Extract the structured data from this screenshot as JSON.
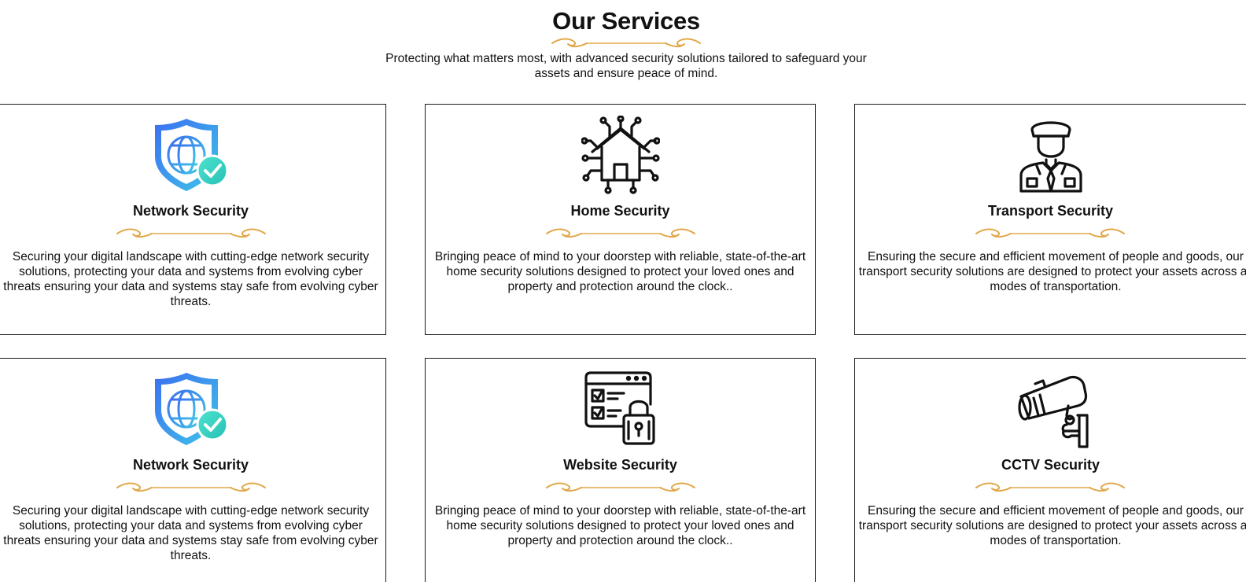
{
  "header": {
    "title": "Our Services",
    "subtitle": "Protecting what matters most, with advanced security solutions tailored to safeguard your assets and ensure peace of mind."
  },
  "colors": {
    "divider_gold": "#E2A84B",
    "shield_blue": "#3B82F6",
    "check_teal": "#34D3C4",
    "border": "#1A1A1A"
  },
  "services": [
    {
      "icon": "shield-globe-check-icon",
      "title": "Network Security",
      "description": "Securing your digital landscape with cutting-edge network security solutions, protecting your data and systems from evolving cyber threats ensuring your data and systems stay safe from evolving cyber threats."
    },
    {
      "icon": "smart-home-circuit-icon",
      "title": "Home Security",
      "description": "Bringing peace of mind to your doorstep with reliable, state-of-the-art home security solutions designed to protect your loved ones and property and protection around the clock.."
    },
    {
      "icon": "security-guard-icon",
      "title": "Transport Security",
      "description": "Ensuring the secure and efficient movement of people and goods, our transport security solutions are designed to protect your assets across all modes of transportation."
    },
    {
      "icon": "shield-globe-check-icon",
      "title": "Network Security",
      "description": "Securing your digital landscape with cutting-edge network security solutions, protecting your data and systems from evolving cyber threats ensuring your data and systems stay safe from evolving cyber threats."
    },
    {
      "icon": "website-lock-icon",
      "title": "Website Security",
      "description": "Bringing peace of mind to your doorstep with reliable, state-of-the-art home security solutions designed to protect your loved ones and property and protection around the clock.."
    },
    {
      "icon": "cctv-camera-icon",
      "title": "CCTV Security",
      "description": "Ensuring the secure and efficient movement of people and goods, our transport security solutions are designed to protect your assets across all modes of transportation."
    }
  ]
}
